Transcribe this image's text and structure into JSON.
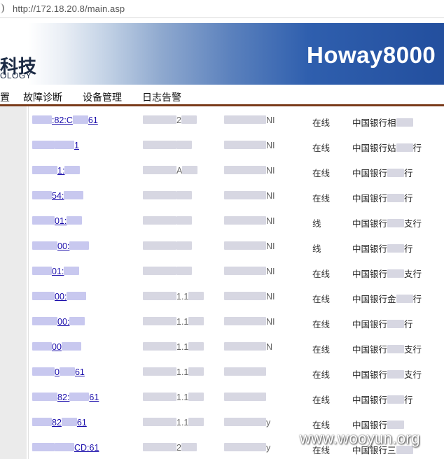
{
  "address_bar": {
    "url": "http://172.18.20.8/main.asp"
  },
  "banner": {
    "logo_cn": "科技",
    "logo_en": "OLOGY",
    "brand": "Howay8000"
  },
  "menu": {
    "items": [
      {
        "label": "置"
      },
      {
        "label": "故障诊断"
      },
      {
        "label": "设备管理"
      },
      {
        "label": "日志告警"
      }
    ]
  },
  "table": {
    "rows": [
      {
        "mac": ":82:C",
        "mac_tail": "61",
        "ip": "2",
        "model": "NI",
        "status": "在线",
        "branch": "中国银行相",
        "branch_tail": ""
      },
      {
        "mac": "",
        "mac_tail": "1",
        "ip": "",
        "model": "NI",
        "status": "在线",
        "branch": "中国银行姑",
        "branch_tail": "行"
      },
      {
        "mac": "1:",
        "mac_tail": "",
        "ip": "A",
        "model": "NI",
        "status": "在线",
        "branch": "中国银行",
        "branch_tail": "行"
      },
      {
        "mac": "54:",
        "mac_tail": "",
        "ip": "",
        "model": "NI",
        "status": "在线",
        "branch": "中国银行",
        "branch_tail": "行"
      },
      {
        "mac": "01:",
        "mac_tail": "",
        "ip": "",
        "model": "NI",
        "status": "线",
        "branch": "中国银行",
        "branch_tail": "支行"
      },
      {
        "mac": "00:",
        "mac_tail": "",
        "ip": "",
        "model": "NI",
        "status": "线",
        "branch": "中国银行",
        "branch_tail": "行"
      },
      {
        "mac": "01:",
        "mac_tail": "",
        "ip": "",
        "model": "NI",
        "status": "在线",
        "branch": "中国银行",
        "branch_tail": "支行"
      },
      {
        "mac": "00:",
        "mac_tail": "",
        "ip": "1.1",
        "model": "NI",
        "status": "在线",
        "branch": "中国银行金",
        "branch_tail": "行"
      },
      {
        "mac": "00:",
        "mac_tail": "",
        "ip": "1.1",
        "model": "NI",
        "status": "在线",
        "branch": "中国银行",
        "branch_tail": "行"
      },
      {
        "mac": "00",
        "mac_tail": "",
        "ip": "1.1",
        "model": "N",
        "status": "在线",
        "branch": "中国银行",
        "branch_tail": "支行"
      },
      {
        "mac": "0",
        "mac_tail": "61",
        "ip": "1.1",
        "model": "",
        "status": "在线",
        "branch": "中国银行",
        "branch_tail": "支行"
      },
      {
        "mac": "82:",
        "mac_tail": "61",
        "ip": "1.1",
        "model": "",
        "status": "在线",
        "branch": "中国银行",
        "branch_tail": "行"
      },
      {
        "mac": "82",
        "mac_tail": "61",
        "ip": "1.1",
        "model": "y",
        "status": "在线",
        "branch": "中国银行",
        "branch_tail": ""
      },
      {
        "mac": "",
        "mac_tail": "CD:61",
        "ip": "2",
        "model": "y",
        "status": "在线",
        "branch": "中国银行三",
        "branch_tail": ""
      }
    ]
  },
  "watermark": "www.wooyun.org",
  "colors": {
    "menu_rule": "#7a3b1a",
    "banner_blue": "#234f9e",
    "link": "#1a0dab"
  }
}
